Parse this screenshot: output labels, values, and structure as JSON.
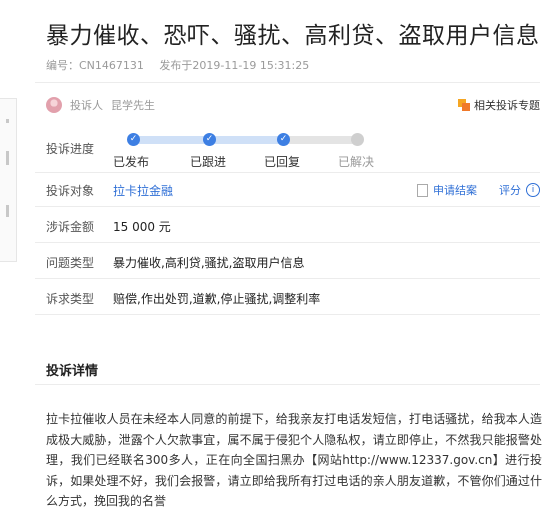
{
  "title": "暴力催收、恐吓、骚扰、高利贷、盗取用户信息",
  "meta": {
    "id_text": "编号：CN1467131",
    "published_text": "发布于2019-11-19 15:31:25"
  },
  "complainant": {
    "label": "投诉人",
    "name": "昆学先生"
  },
  "related_topics": "相关投诉专题",
  "rows": {
    "progress_label": "投诉进度",
    "target_label": "投诉对象",
    "target_value": "拉卡拉金融",
    "amount_label": "涉诉金额",
    "amount_value": "15 000 元",
    "issue_label": "问题类型",
    "issue_value": "暴力催收,高利贷,骚扰,盗取用户信息",
    "demand_label": "诉求类型",
    "demand_value": "赔偿,作出处罚,道歉,停止骚扰,调整利率"
  },
  "progress_steps": [
    {
      "label": "已发布",
      "done": true
    },
    {
      "label": "已跟进",
      "done": true
    },
    {
      "label": "已回复",
      "done": true
    },
    {
      "label": "已解决",
      "done": false
    }
  ],
  "check_glyph": "✓",
  "actions": {
    "apply_close": "申请结案",
    "rate": "评分",
    "info_glyph": "i"
  },
  "details": {
    "section_title": "投诉详情",
    "text": "拉卡拉催收人员在未经本人同意的前提下，给我亲友打电话发短信，打电话骚扰，给我本人造成极大威胁，泄露个人欠款事宜，属不属于侵犯个人隐私权，请立即停止，不然我只能报警处理，我们已经联名300多人，正在向全国扫黑办【网站http://www.12337.gov.cn】进行投诉，如果处理不好，我们会报警，请立即给我所有打过电话的亲人朋友道歉，不管你们通过什么方式，挽回我的名誉"
  },
  "colors": {
    "accent_blue": "#3d7fe3",
    "link_blue": "#2f6fd6",
    "topic_orange": "#f0792a",
    "pending_gray": "#cfcfcf"
  }
}
